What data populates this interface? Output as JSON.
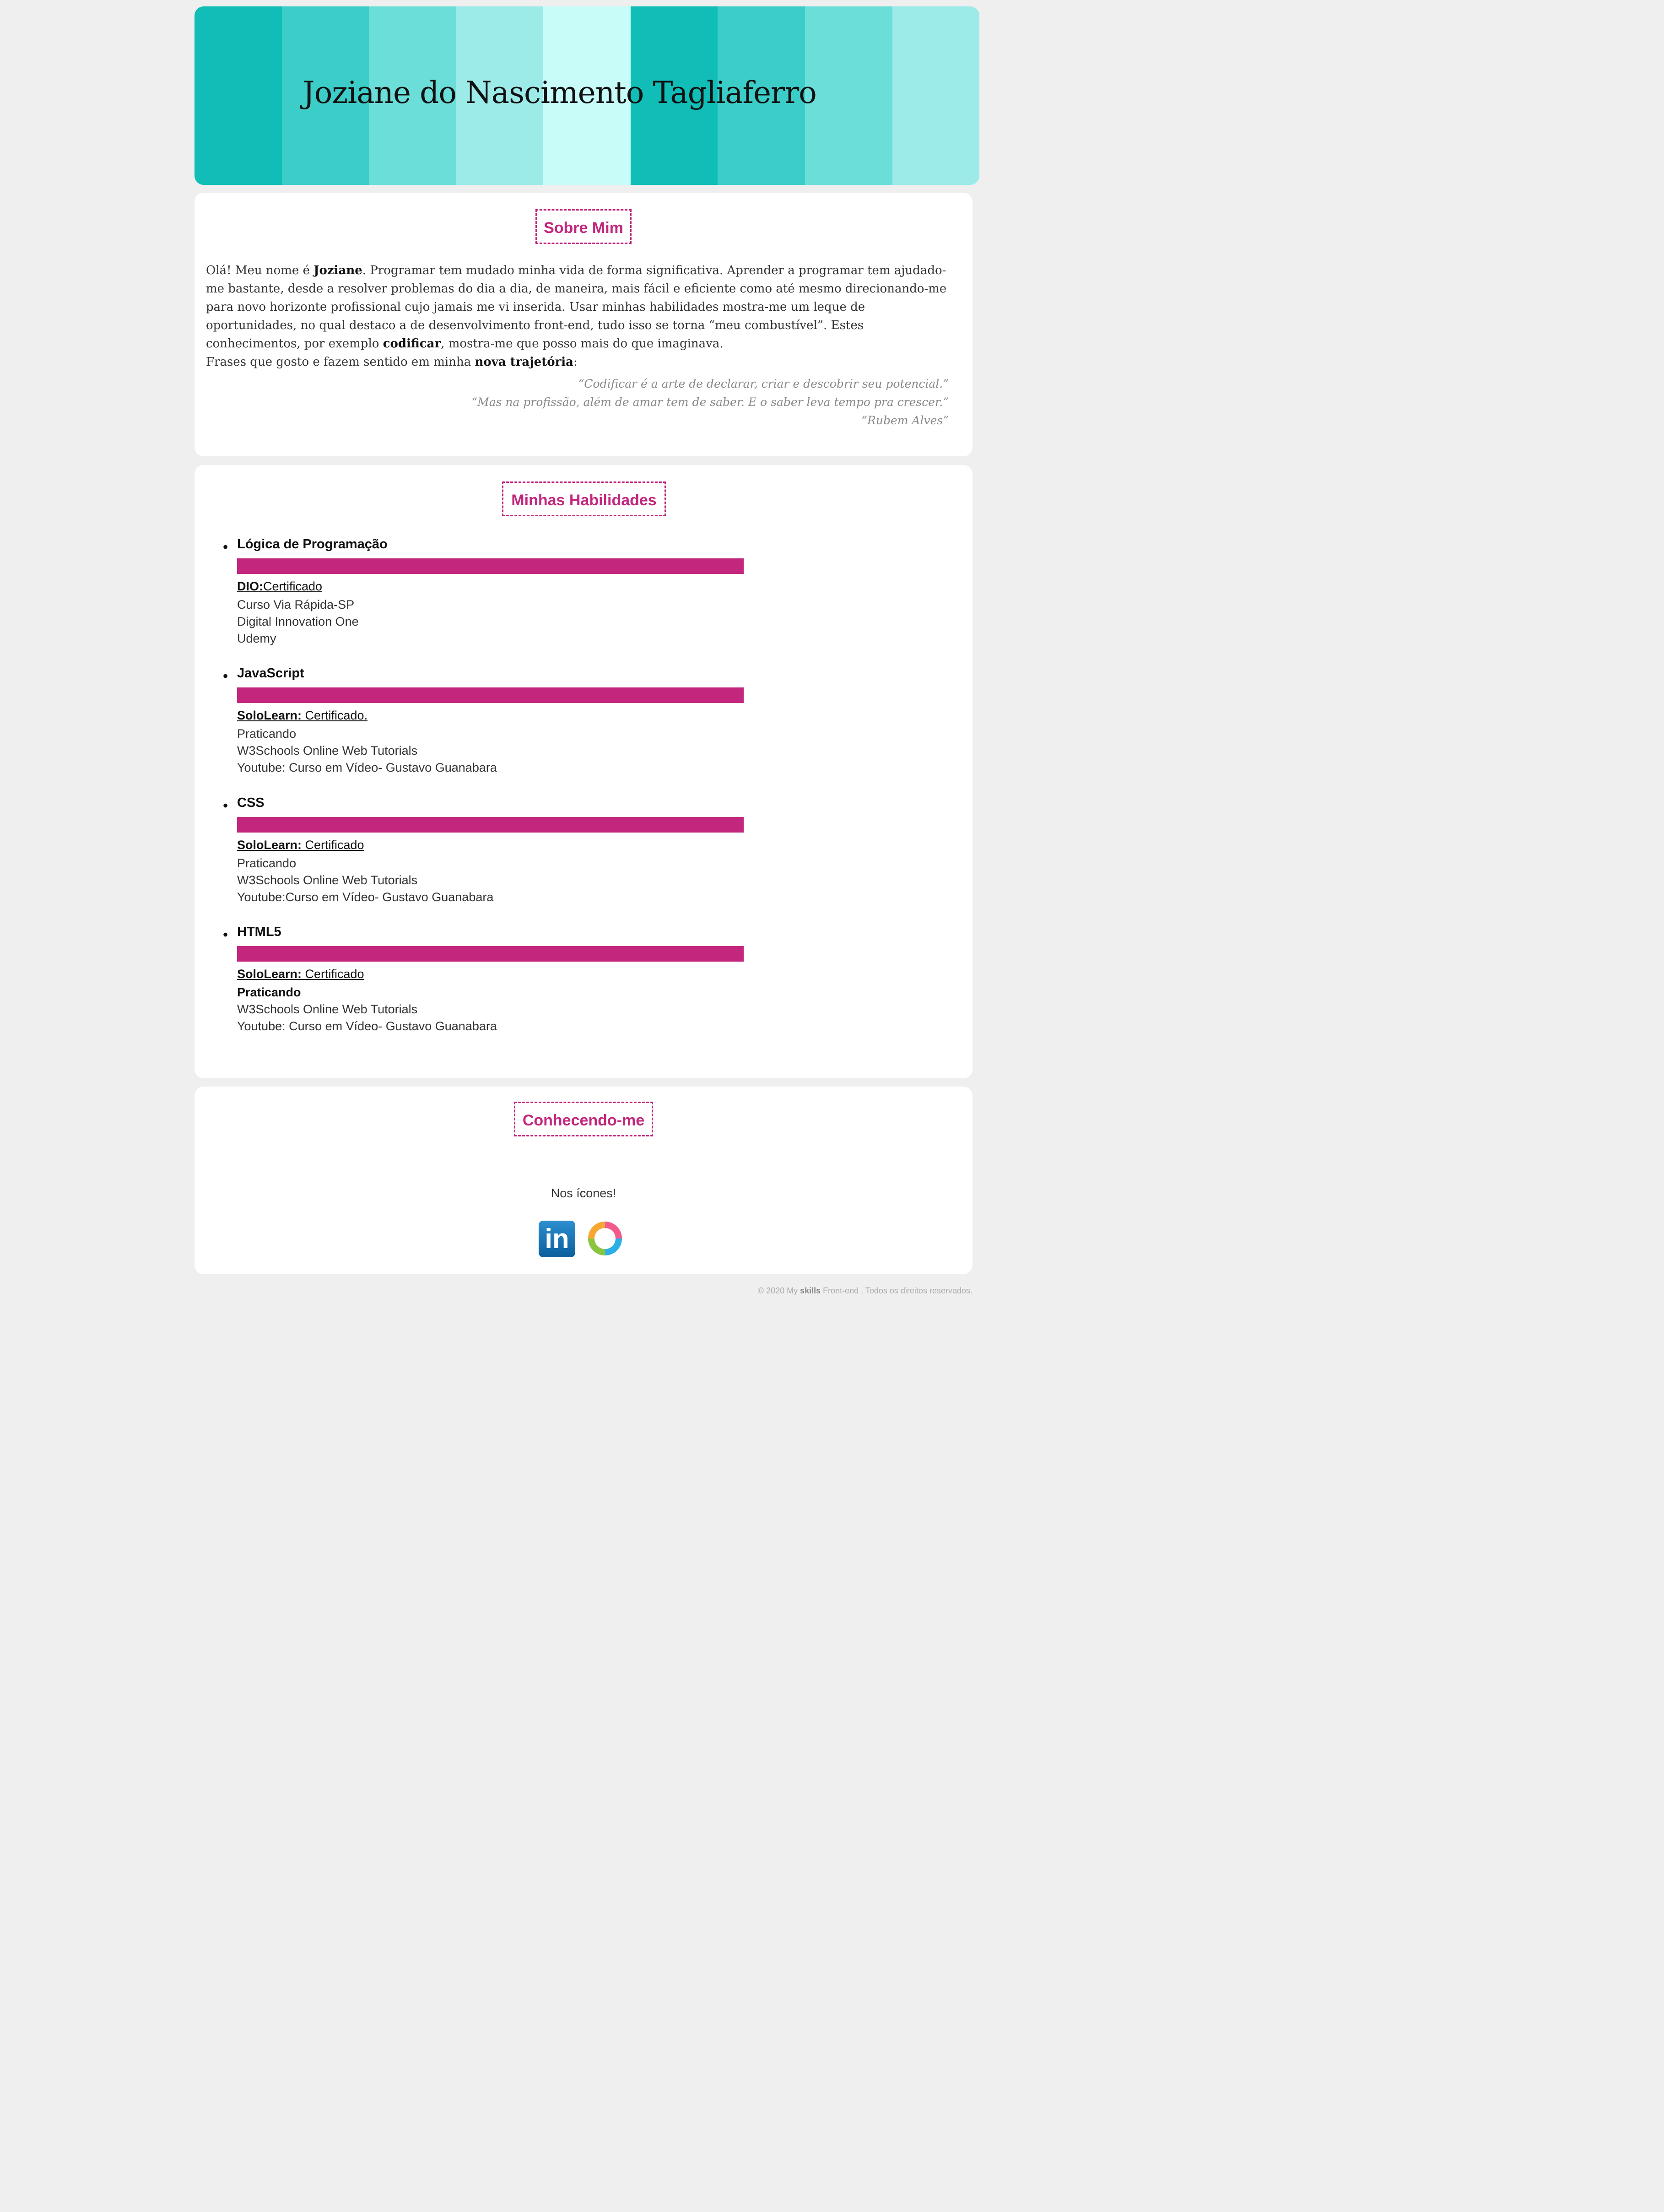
{
  "header": {
    "title": "Joziane do Nascimento Tagliaferro",
    "stripes": [
      "#10bdb7",
      "#3dcdc8",
      "#6cdeda",
      "#9cebe9",
      "#c8fcf8",
      "#10bdb7",
      "#3dcdc8",
      "#6cdeda",
      "#9cebe9"
    ]
  },
  "about": {
    "heading": "Sobre Mim",
    "p1_a": "Olá! Meu nome é ",
    "p1_name": "Joziane",
    "p1_b": ". Programar tem mudado minha vida de forma significativa. Aprender a programar tem ajudado-me bastante, desde a resolver problemas do dia a dia, de maneira, mais fácil e eficiente como até mesmo direcionando-me para novo horizonte profissional cujo jamais me vi inserida. Usar minhas habilidades mostra-me um leque de oportunidades, no qual destaco a de desenvolvimento front-end, tudo isso se torna “meu combustível”. Estes conhecimentos, por exemplo ",
    "p1_code": "codificar",
    "p1_c": ", mostra-me que posso mais do que imaginava.",
    "p2_a": "Frases que gosto e fazem sentido em minha ",
    "p2_bold": "nova trajetória",
    "p2_b": ":",
    "quote1": "“Codificar é a arte de declarar, criar e descobrir seu potencial.”",
    "quote2": "“Mas na profissão, além de amar tem de saber. E o saber leva tempo pra crescer.”",
    "quote3": "“Rubem Alves”"
  },
  "skills": {
    "heading": "Minhas Habilidades",
    "items": [
      {
        "name": "Lógica de Programação",
        "level": 1.0,
        "src_org": "DIO:",
        "src_text": "Certificado",
        "lines": [
          "Curso Via Rápida-SP",
          "Digital Innovation One",
          "Udemy"
        ]
      },
      {
        "name": "JavaScript",
        "level": 1.0,
        "src_org": "SoloLearn:",
        "src_text": " Certificado.",
        "lines": [
          "Praticando",
          "W3Schools Online Web Tutorials",
          "Youtube: Curso em Vídeo- Gustavo Guanabara"
        ]
      },
      {
        "name": "CSS",
        "level": 1.0,
        "src_org": "SoloLearn:",
        "src_text": " Certificado",
        "lines": [
          "Praticando",
          "W3Schools Online Web Tutorials",
          "Youtube:Curso em Vídeo- Gustavo Guanabara"
        ]
      },
      {
        "name": "HTML5",
        "level": 1.0,
        "src_org": "SoloLearn:",
        "src_text": " Certificado",
        "lines": [
          "Praticando",
          "W3Schools Online Web Tutorials",
          "Youtube: Curso em Vídeo- Gustavo Guanabara"
        ]
      }
    ]
  },
  "know": {
    "heading": "Conhecendo-me",
    "note": "Nos ícones!",
    "linkedin_label": "in",
    "icons": [
      "linkedin-icon",
      "sololearn-icon"
    ]
  },
  "footer": {
    "text_a": "© 2020 My ",
    "text_bold": "skills",
    "text_b": " Front-end . Todos os direitos reservados."
  }
}
